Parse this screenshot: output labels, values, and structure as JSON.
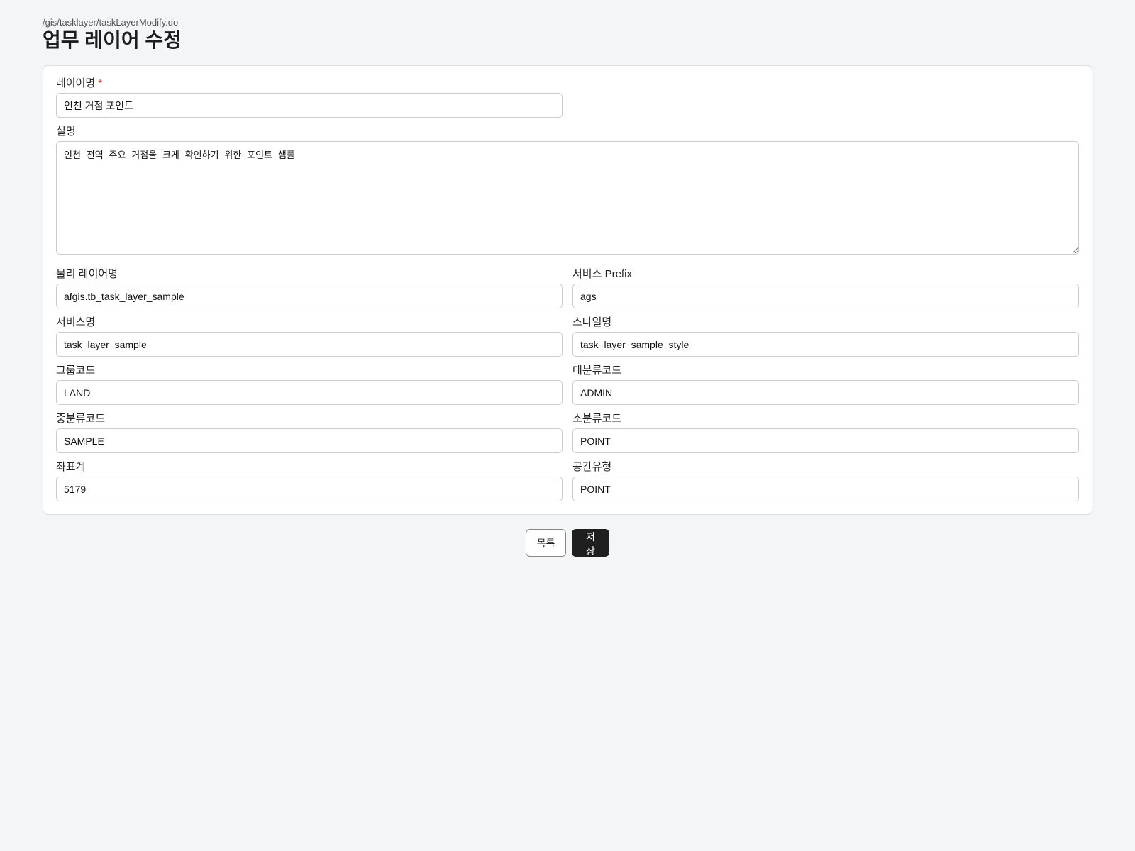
{
  "header": {
    "url": "/gis/tasklayer/taskLayerModify.do",
    "title": "업무 레이어 수정"
  },
  "form": {
    "layer_name": {
      "label": "레이어명",
      "required_mark": "*",
      "value": "인천 거점 포인트"
    },
    "description": {
      "label": "설명",
      "value": "인천 전역 주요 거점을 크게 확인하기 위한 포인트 샘플"
    },
    "physical_layer_name": {
      "label": "물리 레이어명",
      "value": "afgis.tb_task_layer_sample"
    },
    "service_prefix": {
      "label": "서비스 Prefix",
      "value": "ags"
    },
    "service_name": {
      "label": "서비스명",
      "value": "task_layer_sample"
    },
    "style_name": {
      "label": "스타일명",
      "value": "task_layer_sample_style"
    },
    "group_code": {
      "label": "그룹코드",
      "value": "LAND"
    },
    "major_category_code": {
      "label": "대분류코드",
      "value": "ADMIN"
    },
    "middle_category_code": {
      "label": "중분류코드",
      "value": "SAMPLE"
    },
    "minor_category_code": {
      "label": "소분류코드",
      "value": "POINT"
    },
    "coordinate_system": {
      "label": "좌표계",
      "value": "5179"
    },
    "spatial_type": {
      "label": "공간유형",
      "value": "POINT"
    }
  },
  "actions": {
    "list_label": "목록",
    "save_label": "저장"
  }
}
